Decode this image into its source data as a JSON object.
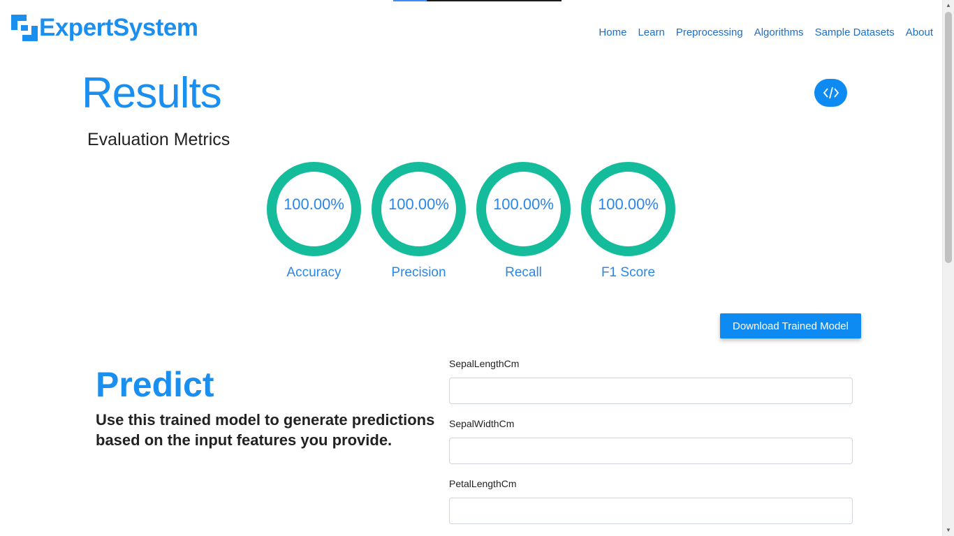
{
  "brand": {
    "name": "ExpertSystem"
  },
  "nav": {
    "items": [
      {
        "label": "Home"
      },
      {
        "label": "Learn"
      },
      {
        "label": "Preprocessing"
      },
      {
        "label": "Algorithms"
      },
      {
        "label": "Sample Datasets"
      },
      {
        "label": "About"
      }
    ]
  },
  "results": {
    "title": "Results",
    "code_icon": "code-icon"
  },
  "evaluation": {
    "title": "Evaluation Metrics",
    "metrics": [
      {
        "label": "Accuracy",
        "value": "100.00%"
      },
      {
        "label": "Precision",
        "value": "100.00%"
      },
      {
        "label": "Recall",
        "value": "100.00%"
      },
      {
        "label": "F1 Score",
        "value": "100.00%"
      }
    ]
  },
  "download": {
    "label": "Download Trained Model"
  },
  "predict": {
    "title": "Predict",
    "description": "Use this trained model to generate predictions based on the input features you provide.",
    "fields": [
      {
        "label": "SepalLengthCm",
        "value": ""
      },
      {
        "label": "SepalWidthCm",
        "value": ""
      },
      {
        "label": "PetalLengthCm",
        "value": ""
      }
    ]
  },
  "colors": {
    "accent": "#1a8ff0",
    "ring": "#14bc9c",
    "button": "#0d8bf2"
  }
}
